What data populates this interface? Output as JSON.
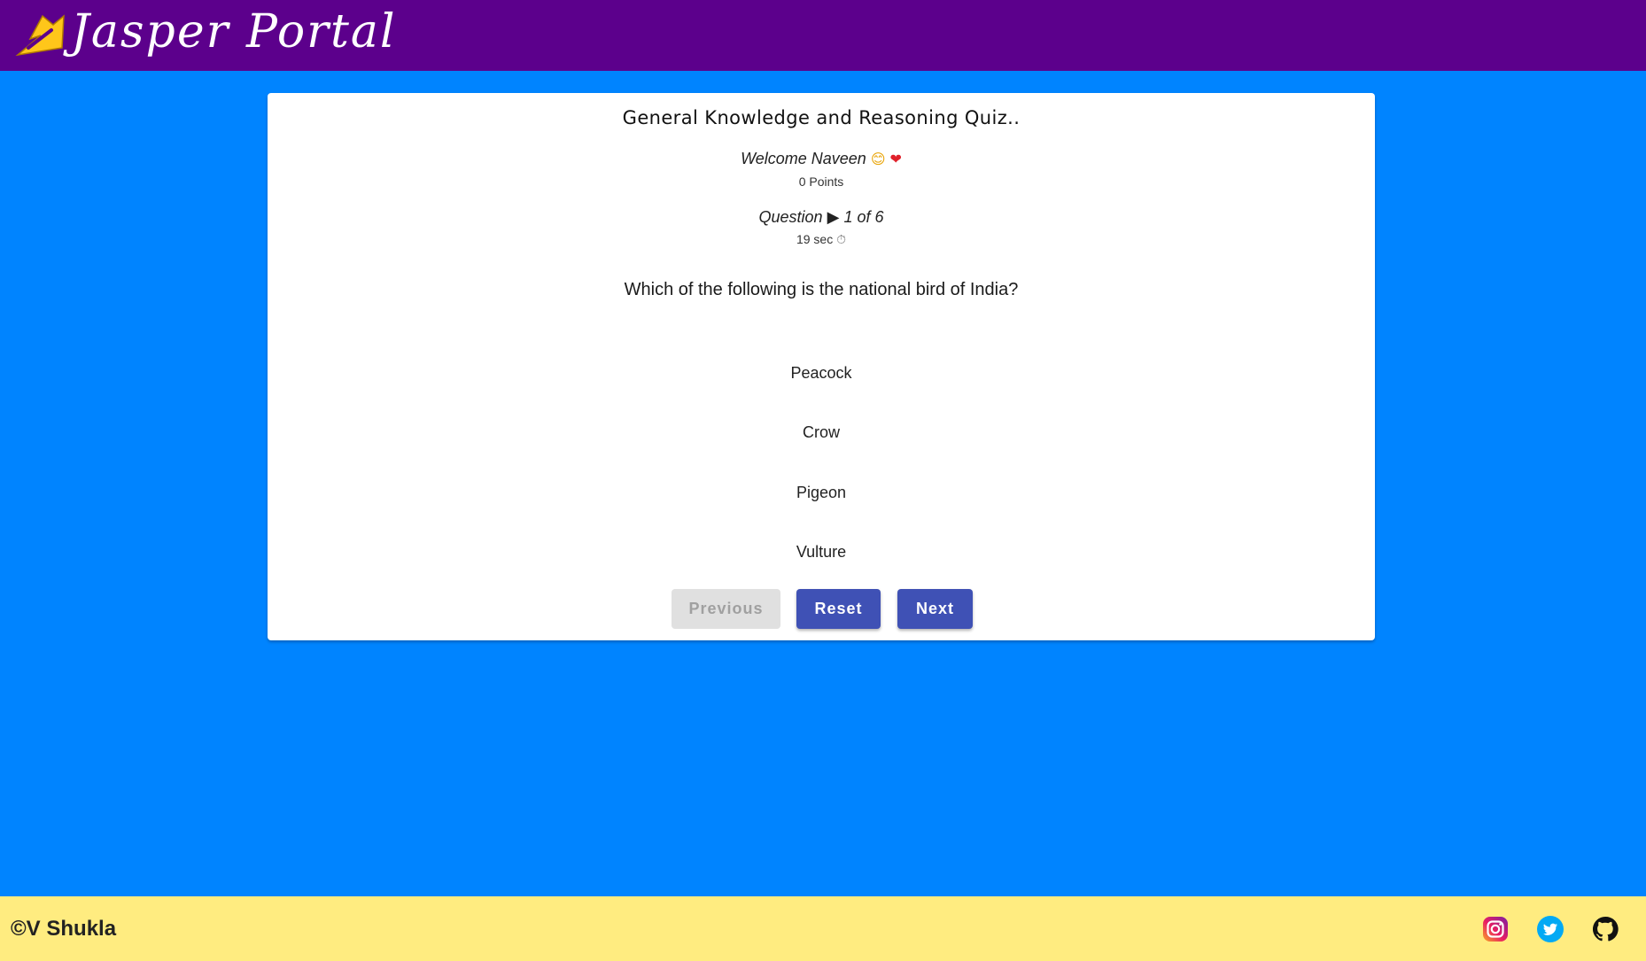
{
  "header": {
    "brand": "Jasper Portal",
    "logo_icon": "lightning-bolt-icon",
    "background_color": "#5c008c",
    "logo_color": "#ffc61a"
  },
  "quiz": {
    "title": "General Knowledge and Reasoning Quiz..",
    "welcome_text": "Welcome Naveen",
    "welcome_emojis": [
      "😊",
      "❤"
    ],
    "points": "0 Points",
    "question_label": "Question",
    "question_arrow": "▶",
    "question_progress": "1 of 6",
    "timer": "19 sec",
    "timer_icon": "⏱",
    "question_text": "Which of the following is the national bird of India?",
    "options": [
      "Peacock",
      "Crow",
      "Pigeon",
      "Vulture"
    ]
  },
  "buttons": {
    "previous": "Previous",
    "reset": "Reset",
    "next": "Next",
    "primary_color": "#3f51b5",
    "disabled_color": "#e0e0e0"
  },
  "footer": {
    "copyright": "©V Shukla",
    "background_color": "#ffec80",
    "socials": [
      "instagram-icon",
      "twitter-icon",
      "github-icon"
    ]
  },
  "page": {
    "background_color": "#0084ff"
  }
}
